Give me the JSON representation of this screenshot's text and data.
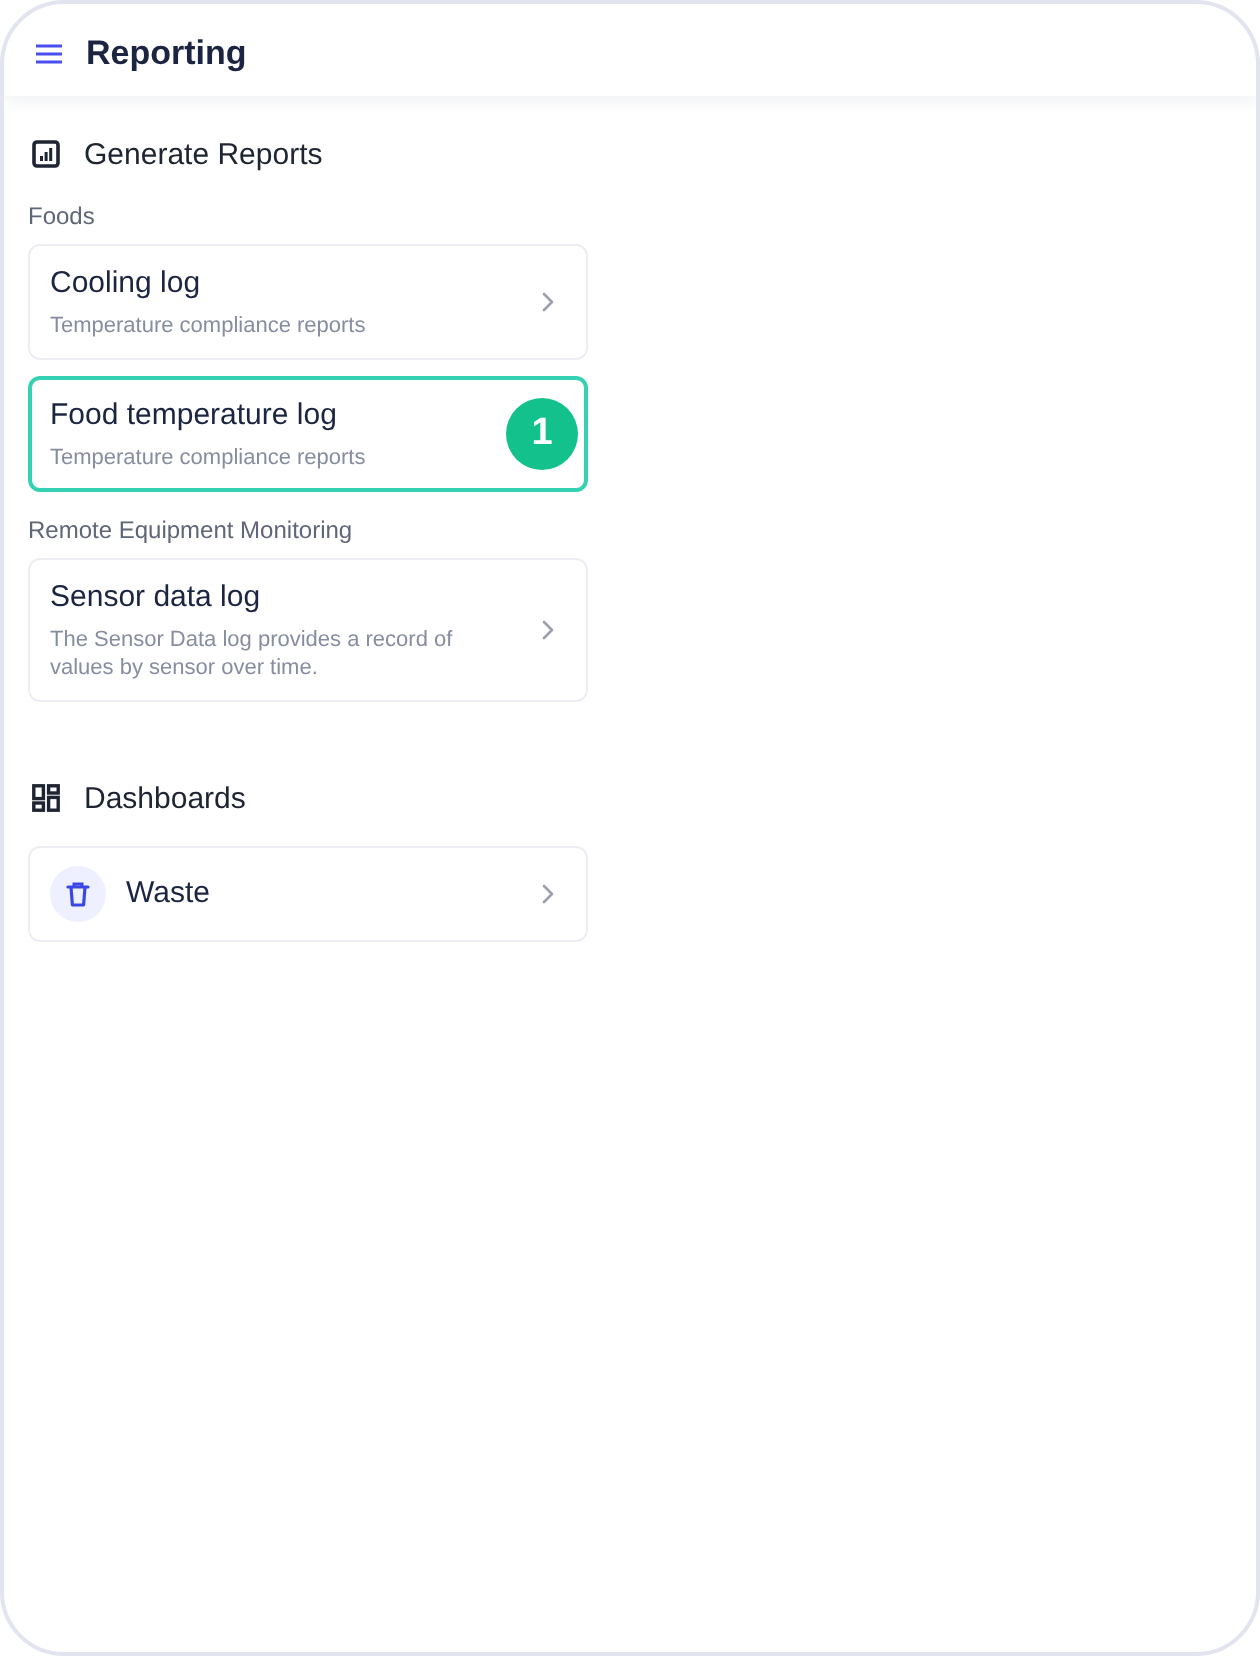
{
  "header": {
    "title": "Reporting"
  },
  "sections": [
    {
      "kind": "reports",
      "title": "Generate Reports",
      "groups": [
        {
          "label": "Foods",
          "items": [
            {
              "kind": "report",
              "title": "Cooling log",
              "subtitle": "Temperature compliance reports",
              "selected": false
            },
            {
              "kind": "report",
              "title": "Food temperature log",
              "subtitle": "Temperature compliance reports",
              "selected": true,
              "badge": "1"
            }
          ]
        },
        {
          "label": "Remote Equipment Monitoring",
          "items": [
            {
              "kind": "report",
              "title": "Sensor data log",
              "subtitle": "The Sensor Data log provides a record of values by sensor over time.",
              "selected": false
            }
          ]
        }
      ]
    },
    {
      "kind": "dashboards",
      "title": "Dashboards",
      "groups": [
        {
          "items": [
            {
              "kind": "dashboard",
              "title": "Waste",
              "selected": false
            }
          ]
        }
      ]
    }
  ]
}
